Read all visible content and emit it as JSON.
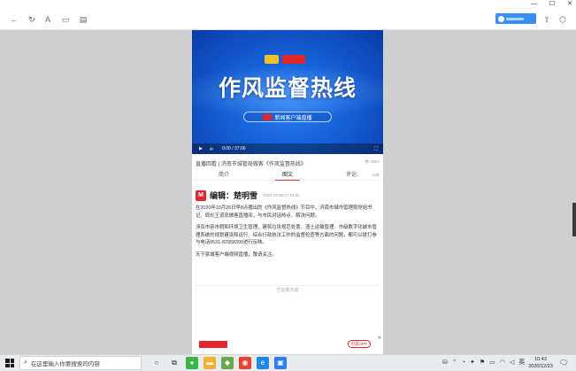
{
  "browser": {
    "ext_text": "·····"
  },
  "video": {
    "headline": "作风监督热线",
    "tagline": "新闻客户端直播",
    "time": "0:00 / 37:06"
  },
  "article": {
    "title": "直播回看 | 济南市城管局做客《作风监督热线》",
    "views": "3057",
    "tabs": [
      "简介",
      "图文",
      "评论"
    ],
    "tab_extra": "22条",
    "editor": "编辑：楚明雪",
    "date": "2020-10-26 07:15:32",
    "paragraphs": [
      "在2020年10月26日早8点播出的《作风监督热线》节目中，济南市城市管理局党组书记、局长王道忠做客直播间，与市民对话热点、解决问题。",
      "涉及市容市貌和环境卫生管理、建筑垃圾规范处置、渣土运输管理、市级数字化城市管理系统的规划建设和运行、综合行政执法工作的监督检查等方面的问题，都可以拨打参与电话0531-82958399进行反映。",
      "天下泉城客户端视频直播，敬请关注。"
    ],
    "loaded": "已加载完成",
    "ad_button": "打开APP"
  },
  "taskbar": {
    "search_placeholder": "在这里输入你要搜索的内容",
    "time": "10:43",
    "date": "2020/12/23"
  }
}
